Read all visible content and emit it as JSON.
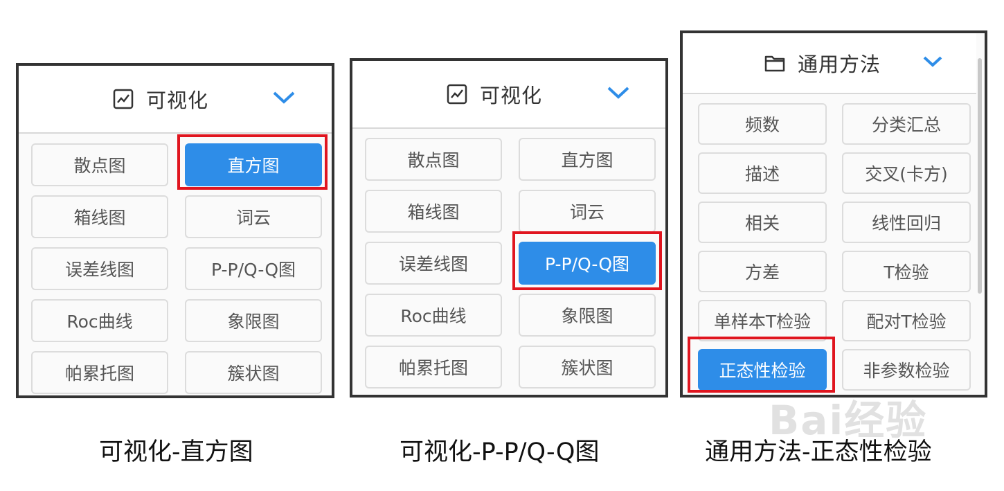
{
  "panels": [
    {
      "header_title": "可视化",
      "header_icon": "chart-line-icon",
      "buttons": [
        "散点图",
        "直方图",
        "箱线图",
        "词云",
        "误差线图",
        "P-P/Q-Q图",
        "Roc曲线",
        "象限图",
        "帕累托图",
        "簇状图"
      ],
      "active_index": 1
    },
    {
      "header_title": "可视化",
      "header_icon": "chart-line-icon",
      "buttons": [
        "散点图",
        "直方图",
        "箱线图",
        "词云",
        "误差线图",
        "P-P/Q-Q图",
        "Roc曲线",
        "象限图",
        "帕累托图",
        "簇状图"
      ],
      "active_index": 5
    },
    {
      "header_title": "通用方法",
      "header_icon": "folder-icon",
      "buttons": [
        "频数",
        "分类汇总",
        "描述",
        "交叉(卡方)",
        "相关",
        "线性回归",
        "方差",
        "T检验",
        "单样本T检验",
        "配对T检验",
        "正态性检验",
        "非参数检验"
      ],
      "active_index": 10
    }
  ],
  "captions": [
    "可视化-直方图",
    "可视化-P-P/Q-Q图",
    "通用方法-正态性检验"
  ],
  "watermark": "Bai经验",
  "colors": {
    "accent": "#2e8de8",
    "highlight": "#e0151f",
    "frame": "#333333"
  }
}
